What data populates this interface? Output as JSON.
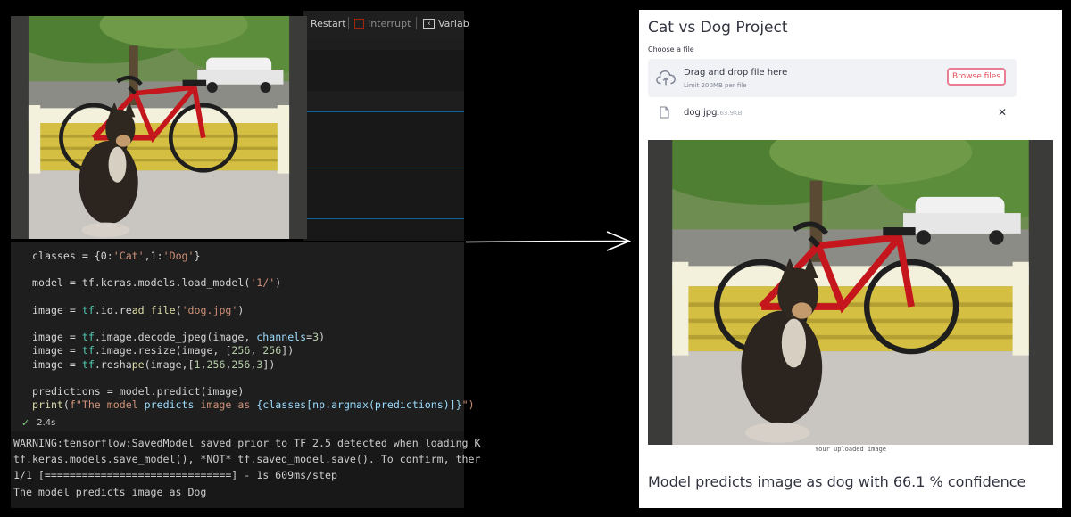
{
  "notebook": {
    "toolbar": {
      "restart": "Restart",
      "interrupt": "Interrupt",
      "variables": "Variab"
    },
    "code_lines": [
      [
        {
          "t": "classes = {0:",
          "c": ""
        },
        {
          "t": "'Cat'",
          "c": "str"
        },
        {
          "t": ",1:",
          "c": ""
        },
        {
          "t": "'Dog'",
          "c": "str"
        },
        {
          "t": "}",
          "c": ""
        }
      ],
      [],
      [
        {
          "t": "model = tf.keras.models.load_model(",
          "c": ""
        },
        {
          "t": "'1/'",
          "c": "str"
        },
        {
          "t": ")",
          "c": ""
        }
      ],
      [],
      [
        {
          "t": "image = ",
          "c": ""
        },
        {
          "t": "tf",
          "c": "tf"
        },
        {
          "t": ".io.re",
          "c": ""
        },
        {
          "t": "ad_file",
          "c": "fn"
        },
        {
          "t": "(",
          "c": ""
        },
        {
          "t": "'dog.jpg'",
          "c": "str"
        },
        {
          "t": ")",
          "c": ""
        }
      ],
      [],
      [
        {
          "t": "image = ",
          "c": ""
        },
        {
          "t": "tf",
          "c": "tf"
        },
        {
          "t": ".image.decode_jpeg(image, ",
          "c": ""
        },
        {
          "t": "channels",
          "c": "kw"
        },
        {
          "t": "=",
          "c": ""
        },
        {
          "t": "3",
          "c": "num"
        },
        {
          "t": ")",
          "c": ""
        }
      ],
      [
        {
          "t": "image = ",
          "c": ""
        },
        {
          "t": "tf",
          "c": "tf"
        },
        {
          "t": ".image.resize(image, [",
          "c": ""
        },
        {
          "t": "256",
          "c": "num"
        },
        {
          "t": ", ",
          "c": ""
        },
        {
          "t": "256",
          "c": "num"
        },
        {
          "t": "])",
          "c": ""
        }
      ],
      [
        {
          "t": "image = ",
          "c": ""
        },
        {
          "t": "tf",
          "c": "tf"
        },
        {
          "t": ".resha",
          "c": ""
        },
        {
          "t": "pe",
          "c": "fn"
        },
        {
          "t": "(image,[",
          "c": ""
        },
        {
          "t": "1",
          "c": "num"
        },
        {
          "t": ",",
          "c": ""
        },
        {
          "t": "256",
          "c": "num"
        },
        {
          "t": ",",
          "c": ""
        },
        {
          "t": "256",
          "c": "num"
        },
        {
          "t": ",",
          "c": ""
        },
        {
          "t": "3",
          "c": "num"
        },
        {
          "t": "])",
          "c": ""
        }
      ],
      [],
      [
        {
          "t": "predictions = model.predict(image)",
          "c": ""
        }
      ],
      [
        {
          "t": "print",
          "c": "fn"
        },
        {
          "t": "(",
          "c": ""
        },
        {
          "t": "f\"The model ",
          "c": "str"
        },
        {
          "t": "predicts",
          "c": "kw"
        },
        {
          "t": " image as ",
          "c": "str"
        },
        {
          "t": "{classes[np.argmax(predictions)]}",
          "c": "kw"
        },
        {
          "t": "\")",
          "c": "str"
        }
      ]
    ],
    "exec_time": "2.4s",
    "output_lines": [
      "WARNING:tensorflow:SavedModel saved prior to TF 2.5 detected when loading K",
      "tf.keras.models.save_model(), *NOT* tf.saved_model.save(). To confirm, ther",
      "1/1 [==============================] - 1s 609ms/step",
      "The model predicts image as Dog"
    ]
  },
  "app": {
    "title": "Cat vs Dog Project",
    "uploader_label": "Choose a file",
    "dropzone_text": "Drag and drop file here",
    "dropzone_limit": "Limit 200MB per file",
    "browse_label": "Browse files",
    "file_name": "dog.jpg",
    "file_size": "163.9KB",
    "image_caption": "Your uploaded image",
    "prediction": "Model predicts image as dog with 66.1 % confidence"
  },
  "colors": {
    "accent": "#e0515f",
    "vscode_bg": "#1e1e1e",
    "check": "#89d185"
  }
}
